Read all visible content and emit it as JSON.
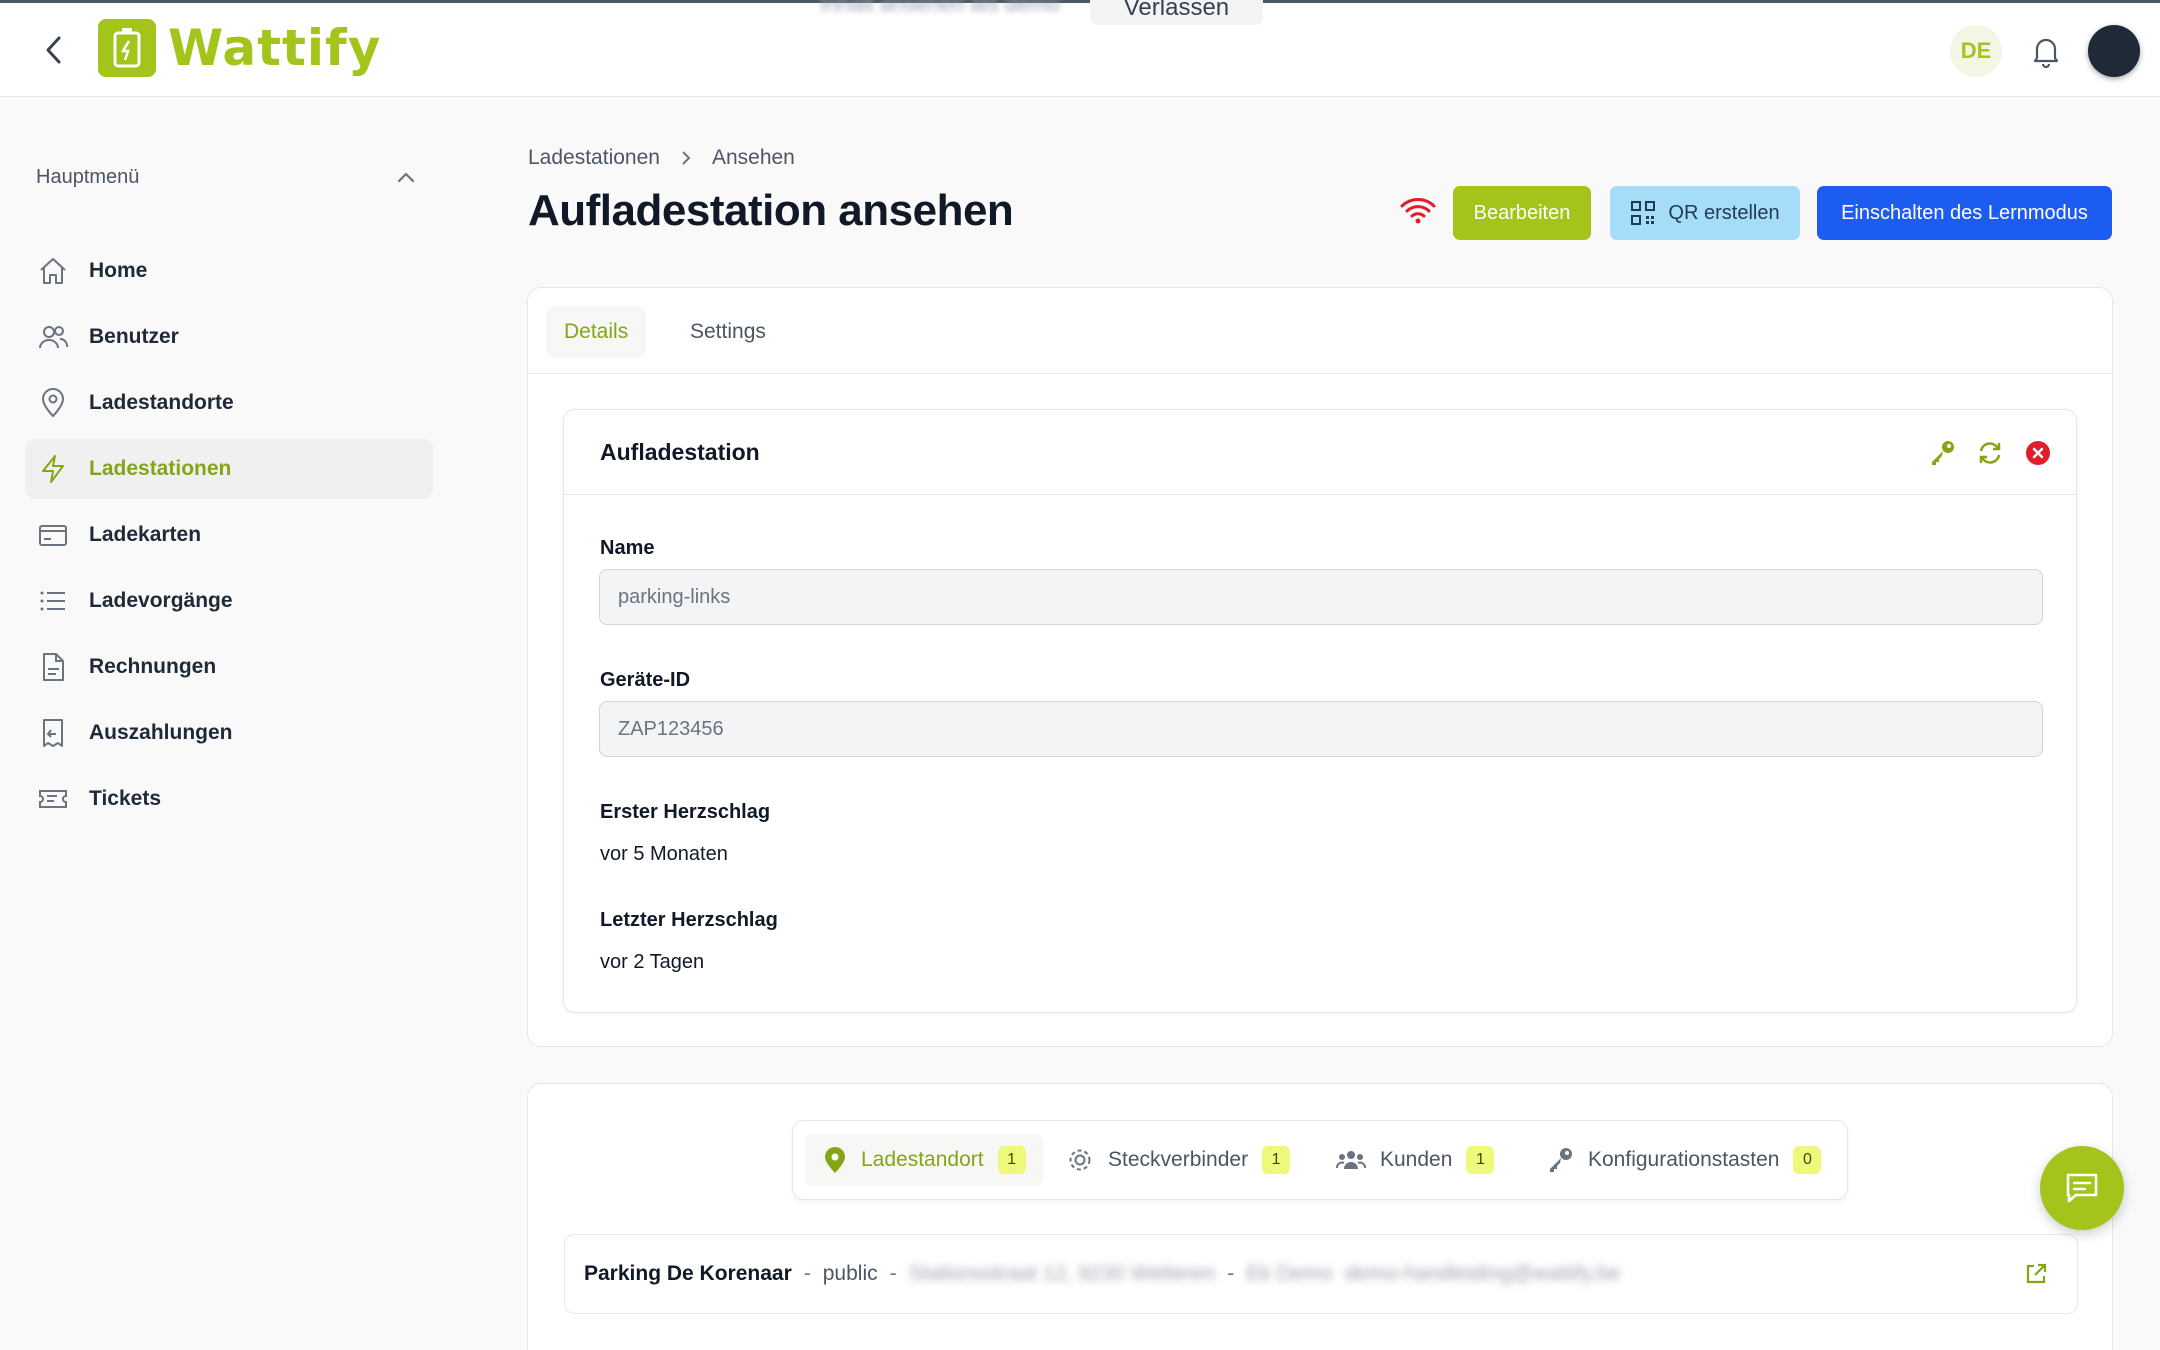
{
  "app": {
    "name": "Wattify",
    "language": "DE"
  },
  "floating_bar": {
    "blurred_text": "Inhalt ansehen als demo",
    "leave_label": "Verlassen"
  },
  "sidebar": {
    "menu_title": "Hauptmenü",
    "items": [
      {
        "label": "Home",
        "icon": "home-icon"
      },
      {
        "label": "Benutzer",
        "icon": "users-icon"
      },
      {
        "label": "Ladestandorte",
        "icon": "location-pin-icon"
      },
      {
        "label": "Ladestationen",
        "icon": "bolt-icon",
        "active": true
      },
      {
        "label": "Ladekarten",
        "icon": "card-icon"
      },
      {
        "label": "Ladevorgänge",
        "icon": "list-icon"
      },
      {
        "label": "Rechnungen",
        "icon": "document-icon"
      },
      {
        "label": "Auszahlungen",
        "icon": "receipt-icon"
      },
      {
        "label": "Tickets",
        "icon": "ticket-icon"
      }
    ]
  },
  "breadcrumb": {
    "parent": "Ladestationen",
    "current": "Ansehen"
  },
  "page": {
    "title": "Aufladestation ansehen"
  },
  "actions": {
    "edit": "Bearbeiten",
    "qr": "QR erstellen",
    "learn": "Einschalten des Lernmodus"
  },
  "tabs": {
    "details": "Details",
    "settings": "Settings"
  },
  "station_card": {
    "title": "Aufladestation",
    "fields": {
      "name_label": "Name",
      "name_value": "parking-links",
      "device_label": "Geräte-ID",
      "device_value": "ZAP123456",
      "first_hb_label": "Erster Herzschlag",
      "first_hb_value": "vor 5 Monaten",
      "last_hb_label": "Letzter Herzschlag",
      "last_hb_value": "vor 2 Tagen"
    }
  },
  "relations": {
    "tabs": [
      {
        "label": "Ladestandort",
        "count": "1",
        "icon": "location-pin-icon"
      },
      {
        "label": "Steckverbinder",
        "count": "1",
        "icon": "gear-icon"
      },
      {
        "label": "Kunden",
        "count": "1",
        "icon": "group-icon"
      },
      {
        "label": "Konfigurationstasten",
        "count": "0",
        "icon": "key-icon"
      }
    ],
    "location_row": {
      "name": "Parking De Korenaar",
      "visibility": "public",
      "address_blurred": "Stationsstraat 12, 9230 Wetteren",
      "owner_blurred": "Ek Demo",
      "email_blurred": "demo-handleiding@wattify.be"
    }
  },
  "colors": {
    "brand": "#a3c41b",
    "primary": "#1d5cf0",
    "danger": "#e11d2a",
    "qr_bg": "#a5dcf8"
  }
}
